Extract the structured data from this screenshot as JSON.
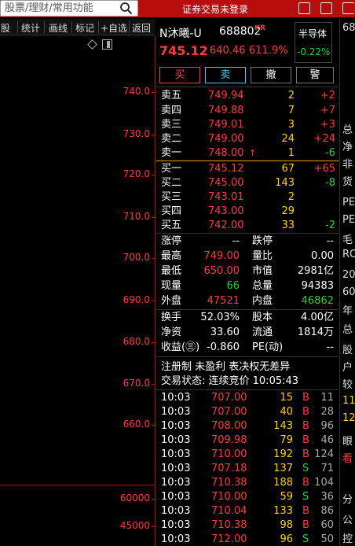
{
  "topbar": {
    "search_placeholder": "股票/理财/常用功能",
    "login_status": "证券交易未登录"
  },
  "chart_toolbar": {
    "items": [
      "F股",
      "统计",
      "画线",
      "标记",
      "+自选",
      "返回"
    ]
  },
  "chart": {
    "price_labels": [
      "740.0",
      "730.0",
      "720.0",
      "710.0",
      "700.0",
      "690.0",
      "680.0",
      "670.0",
      "660.0"
    ],
    "volume_labels": [
      "60000",
      "45000"
    ]
  },
  "stock": {
    "name": "N沐曦-U",
    "code": "688802",
    "market_tag": "KR",
    "sector": "半导体",
    "price": "745.12",
    "change": "640.46",
    "change_pct": "611.9%",
    "sector_change": "-0.22%"
  },
  "actions": {
    "buy": "买",
    "sell": "卖",
    "cancel": "撤",
    "alert": "警"
  },
  "ask": [
    {
      "label": "卖五",
      "price": "749.94",
      "vol": "2",
      "chg": "+2"
    },
    {
      "label": "卖四",
      "price": "749.88",
      "vol": "7",
      "chg": "+7"
    },
    {
      "label": "卖三",
      "price": "749.01",
      "vol": "3",
      "chg": "+3"
    },
    {
      "label": "卖二",
      "price": "749.00",
      "vol": "24",
      "chg": "+24"
    },
    {
      "label": "卖一",
      "price": "748.00",
      "vol": "1",
      "chg": "-6"
    }
  ],
  "bid": [
    {
      "label": "买一",
      "price": "745.12",
      "vol": "67",
      "chg": "+65"
    },
    {
      "label": "买二",
      "price": "745.00",
      "vol": "143",
      "chg": "-8"
    },
    {
      "label": "买三",
      "price": "743.01",
      "vol": "2",
      "chg": ""
    },
    {
      "label": "买四",
      "price": "743.00",
      "vol": "29",
      "chg": ""
    },
    {
      "label": "买五",
      "price": "742.00",
      "vol": "33",
      "chg": "-2"
    }
  ],
  "stats1": [
    {
      "l1": "涨停",
      "v1": "--",
      "l2": "跌停",
      "v2": "--"
    },
    {
      "l1": "最高",
      "v1": "749.00",
      "l2": "量比",
      "v2": "0.00"
    },
    {
      "l1": "最低",
      "v1": "650.00",
      "l2": "市值",
      "v2": "2981亿"
    },
    {
      "l1": "现量",
      "v1": "66",
      "l2": "总量",
      "v2": "94383"
    },
    {
      "l1": "外盘",
      "v1": "47521",
      "l2": "内盘",
      "v2": "46862"
    }
  ],
  "stats2": [
    {
      "l1": "换手",
      "v1": "52.03%",
      "l2": "股本",
      "v2": "4.00亿"
    },
    {
      "l1": "净资",
      "v1": "33.60",
      "l2": "流通",
      "v2": "1814万"
    },
    {
      "l1": "收益(㊂)",
      "v1": "-0.860",
      "l2": "PE(动)",
      "v2": "--"
    }
  ],
  "notes": {
    "flags": "注册制 未盈利 表决权无差异",
    "status": "交易状态: 连续竞价 10:05:43"
  },
  "ticks": [
    {
      "t": "10:03",
      "p": "707.00",
      "v": "15",
      "d": "B",
      "n": "11"
    },
    {
      "t": "10:03",
      "p": "707.00",
      "v": "40",
      "d": "B",
      "n": "28"
    },
    {
      "t": "10:03",
      "p": "708.00",
      "v": "143",
      "d": "B",
      "n": "96"
    },
    {
      "t": "10:03",
      "p": "709.98",
      "v": "79",
      "d": "B",
      "n": "46"
    },
    {
      "t": "10:03",
      "p": "710.00",
      "v": "192",
      "d": "B",
      "n": "124"
    },
    {
      "t": "10:03",
      "p": "707.18",
      "v": "137",
      "d": "S",
      "n": "71"
    },
    {
      "t": "10:03",
      "p": "710.38",
      "v": "188",
      "d": "B",
      "n": "104"
    },
    {
      "t": "10:03",
      "p": "710.00",
      "v": "59",
      "d": "S",
      "n": "36"
    },
    {
      "t": "10:03",
      "p": "710.04",
      "v": "133",
      "d": "B",
      "n": "86"
    },
    {
      "t": "10:03",
      "p": "710.38",
      "v": "98",
      "d": "B",
      "n": "60"
    },
    {
      "t": "10:03",
      "p": "712.00",
      "v": "96",
      "d": "S",
      "n": "50"
    }
  ],
  "right_strip": [
    "68",
    "总",
    "净",
    "非",
    "货",
    "PE",
    "PE",
    "毛",
    "RO",
    "20",
    "60",
    "年",
    "总",
    "股",
    "户",
    "较",
    "11",
    "12",
    "眼",
    "看",
    "分",
    "公",
    "控"
  ]
}
